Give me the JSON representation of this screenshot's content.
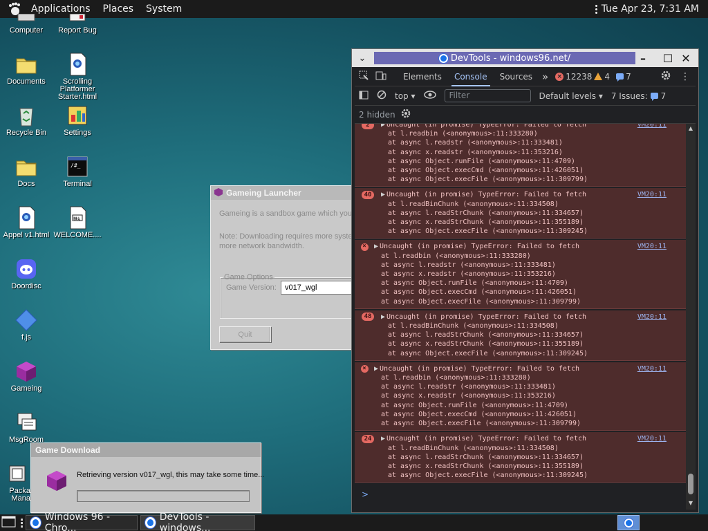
{
  "topbar": {
    "applications": "Applications",
    "places": "Places",
    "system": "System",
    "clock": "Tue Apr 23,  7:31 AM"
  },
  "desktop": {
    "icons": [
      {
        "label": "Computer",
        "icon": "computer-icon"
      },
      {
        "label": "Report Bug",
        "icon": "report-bug-icon"
      },
      {
        "label": "Documents",
        "icon": "folder-icon"
      },
      {
        "label": "Scrolling Platformer Starter.html",
        "icon": "html-file-icon"
      },
      {
        "label": "Recycle Bin",
        "icon": "recycle-bin-icon"
      },
      {
        "label": "Settings",
        "icon": "settings-icon"
      },
      {
        "label": "Docs",
        "icon": "folder-icon"
      },
      {
        "label": "Terminal",
        "icon": "terminal-icon"
      },
      {
        "label": "Appel v1.html",
        "icon": "html-file-icon"
      },
      {
        "label": "WELCOME....",
        "icon": "markdown-file-icon"
      },
      {
        "label": "Doordisc",
        "icon": "doordisc-icon"
      },
      {
        "label": "f.js",
        "icon": "js-file-icon"
      },
      {
        "label": "Gameing",
        "icon": "cube-icon"
      },
      {
        "label": "MsgRoom",
        "icon": "msgroom-icon"
      },
      {
        "label": "Packa Mana",
        "icon": "package-manager-icon"
      }
    ]
  },
  "launcher": {
    "title": "Gameing Launcher",
    "description": "Gameing is a sandbox game which you ca",
    "note_line1": "Note: Downloading requires more system R",
    "note_line2": "more network bandwidth.",
    "options_legend": "Game Options",
    "version_label": "Game Version:",
    "version_value": "v017_wgl",
    "quit_label": "Quit"
  },
  "download": {
    "title": "Game Download",
    "message": "Retrieving version v017_wgl, this may take some time...",
    "progress": 0
  },
  "devtools": {
    "window_title": "DevTools - windows96.net/",
    "tabs": [
      "Elements",
      "Console",
      "Sources"
    ],
    "more_tabs": "»",
    "errors_count": "12238",
    "warnings_count": "4",
    "messages_count": "7",
    "context": "top",
    "filter_placeholder": "Filter",
    "levels": "Default levels",
    "issues_label": "7 Issues:",
    "issues_count": "7",
    "hidden": "2 hidden",
    "logs": [
      {
        "count": "2",
        "kind": "count",
        "head": "Uncaught (in promise) TypeError: Failed to fetch",
        "src": "VM20:11",
        "lines": [
          "at l.readbin (<anonymous>:11:333280)",
          "at async l.readstr (<anonymous>:11:333481)",
          "at async x.readstr (<anonymous>:11:353216)",
          "at async Object.runFile (<anonymous>:11:4709)",
          "at async Object.execCmd (<anonymous>:11:426051)",
          "at async Object.execFile (<anonymous>:11:309799)"
        ]
      },
      {
        "count": "40",
        "kind": "count",
        "head": "Uncaught (in promise) TypeError: Failed to fetch",
        "src": "VM20:11",
        "lines": [
          "at l.readBinChunk (<anonymous>:11:334508)",
          "at async l.readStrChunk (<anonymous>:11:334657)",
          "at async x.readStrChunk (<anonymous>:11:355189)",
          "at async Object.execFile (<anonymous>:11:309245)"
        ]
      },
      {
        "count": "",
        "kind": "x",
        "head": "Uncaught (in promise) TypeError: Failed to fetch",
        "src": "VM20:11",
        "lines": [
          "at l.readbin (<anonymous>:11:333280)",
          "at async l.readstr (<anonymous>:11:333481)",
          "at async x.readstr (<anonymous>:11:353216)",
          "at async Object.runFile (<anonymous>:11:4709)",
          "at async Object.execCmd (<anonymous>:11:426051)",
          "at async Object.execFile (<anonymous>:11:309799)"
        ]
      },
      {
        "count": "48",
        "kind": "count",
        "head": "Uncaught (in promise) TypeError: Failed to fetch",
        "src": "VM20:11",
        "lines": [
          "at l.readBinChunk (<anonymous>:11:334508)",
          "at async l.readStrChunk (<anonymous>:11:334657)",
          "at async x.readStrChunk (<anonymous>:11:355189)",
          "at async Object.execFile (<anonymous>:11:309245)"
        ]
      },
      {
        "count": "",
        "kind": "x",
        "head": "Uncaught (in promise) TypeError: Failed to fetch",
        "src": "VM20:11",
        "lines": [
          "at l.readbin (<anonymous>:11:333280)",
          "at async l.readstr (<anonymous>:11:333481)",
          "at async x.readstr (<anonymous>:11:353216)",
          "at async Object.runFile (<anonymous>:11:4709)",
          "at async Object.execCmd (<anonymous>:11:426051)",
          "at async Object.execFile (<anonymous>:11:309799)"
        ]
      },
      {
        "count": "24",
        "kind": "count",
        "head": "Uncaught (in promise) TypeError: Failed to fetch",
        "src": "VM20:11",
        "lines": [
          "at l.readBinChunk (<anonymous>:11:334508)",
          "at async l.readStrChunk (<anonymous>:11:334657)",
          "at async x.readStrChunk (<anonymous>:11:355189)",
          "at async Object.execFile (<anonymous>:11:309245)"
        ]
      }
    ],
    "prompt": ">"
  },
  "taskbar": {
    "items": [
      {
        "label": "Windows 96 - Chro...",
        "icon": "chrome-icon"
      },
      {
        "label": "DevTools - windows...",
        "icon": "chrome-icon"
      }
    ]
  },
  "colors": {
    "error_bg": "#4e2c2c",
    "error_badge": "#e46962",
    "accent": "#a8c7fa"
  }
}
